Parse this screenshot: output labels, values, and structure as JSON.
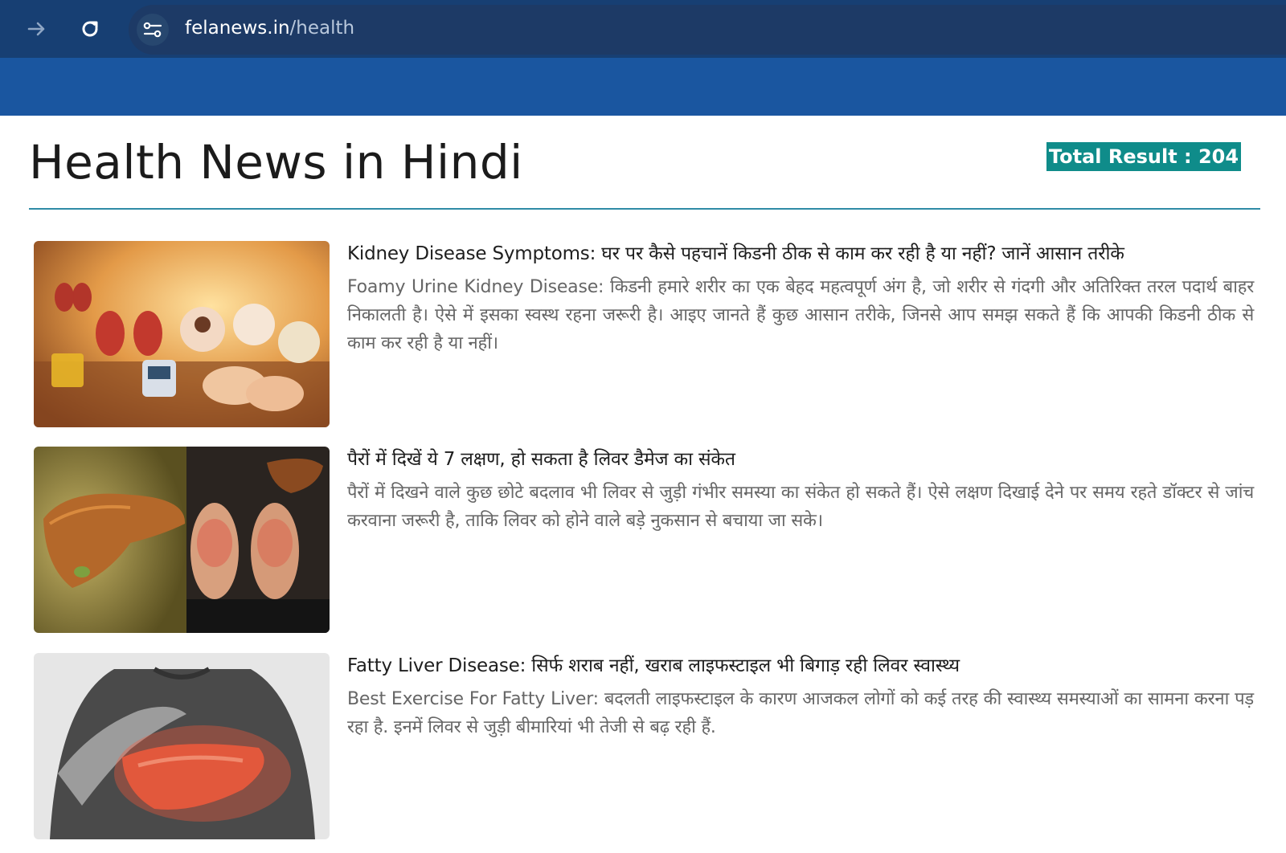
{
  "browser": {
    "url_domain": "felanews.in",
    "url_path": "/health",
    "icons": [
      "forward-arrow-icon",
      "reload-icon",
      "site-settings-icon"
    ]
  },
  "page": {
    "title": "Health News in Hindi",
    "total_result": "Total Result : 204"
  },
  "colors": {
    "chrome": "#173f73",
    "site_band": "#1a56a0",
    "badge": "#0f8c8a",
    "rule": "#2f8ba6"
  },
  "articles": [
    {
      "headline": "Kidney Disease Symptoms: घर पर कैसे पहचानें किडनी ठीक से काम कर रही है या नहीं? जानें आसान तरीके",
      "summary": "Foamy Urine Kidney Disease: किडनी हमारे शरीर का एक बेहद महत्वपूर्ण अंग है, जो शरीर से गंदगी और अतिरिक्त तरल पदार्थ बाहर निकालती है। ऐसे में इसका स्वस्थ रहना जरूरी है। आइए जानते हैं कुछ आसान तरीके, जिनसे आप समझ सकते हैं कि आपकी किडनी ठीक से काम कर रही है या नहीं।",
      "image": "kidney-illustration"
    },
    {
      "headline": "पैरों में दिखें ये 7 लक्षण, हो सकता है लिवर डैमेज का संकेत",
      "summary": "पैरों में दिखने वाले कुछ छोटे बदलाव भी लिवर से जुड़ी गंभीर समस्या का संकेत हो सकते हैं। ऐसे लक्षण दिखाई देने पर समय रहते डॉक्टर से जांच करवाना जरूरी है, ताकि लिवर को होने वाले बड़े नुकसान से बचाया जा सके।",
      "image": "liver-feet-illustration"
    },
    {
      "headline": "Fatty Liver Disease: सिर्फ शराब नहीं, खराब लाइफस्टाइल भी बिगाड़ रही लिवर स्वास्थ्य",
      "summary": "Best Exercise For Fatty Liver: बदलती लाइफस्टाइल के कारण आजकल लोगों को कई तरह की स्वास्थ्य समस्याओं का सामना करना पड़ रहा है. इनमें लिवर से जुड़ी बीमारियां भी तेजी से बढ़ रही हैं.",
      "image": "fatty-liver-illustration"
    }
  ]
}
